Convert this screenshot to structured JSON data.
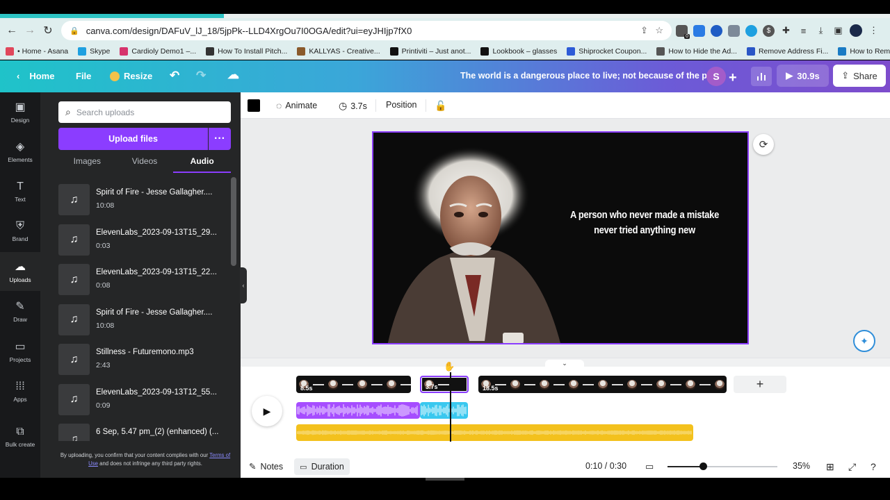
{
  "browser": {
    "url": "canva.com/design/DAFuV_lJ_18/5jpPk--LLD4XrgOu7I0OGA/edit?ui=eyJHIjp7fX0",
    "bookmarks": [
      {
        "label": "• Home - Asana",
        "color": "#e0475b"
      },
      {
        "label": "Skype",
        "color": "#1ea0e0"
      },
      {
        "label": "Cardioly Demo1 –...",
        "color": "#d6336c"
      },
      {
        "label": "How To Install Pitch...",
        "color": "#333333"
      },
      {
        "label": "KALLYAS - Creative...",
        "color": "#8a5a2b"
      },
      {
        "label": "Printiviti – Just anot...",
        "color": "#111111"
      },
      {
        "label": "Lookbook – glasses",
        "color": "#111111"
      },
      {
        "label": "Shiprocket Coupon...",
        "color": "#2d5bd7"
      },
      {
        "label": "How to Hide the Ad...",
        "color": "#555555"
      },
      {
        "label": "Remove Address Fi...",
        "color": "#2a56c6"
      },
      {
        "label": "How to Remove / D...",
        "color": "#1a7bc4"
      }
    ],
    "extension_badge": "0"
  },
  "header": {
    "home": "Home",
    "file": "File",
    "resize": "Resize",
    "title": "The world is a dangerous place to live; not because of the p...",
    "avatar_initial": "S",
    "play_time": "30.9s",
    "share": "Share"
  },
  "rail": [
    {
      "label": "Design",
      "icon": "design-icon",
      "glyph": "▣"
    },
    {
      "label": "Elements",
      "icon": "elements-icon",
      "glyph": "◈"
    },
    {
      "label": "Text",
      "icon": "text-icon",
      "glyph": "T"
    },
    {
      "label": "Brand",
      "icon": "brand-icon",
      "glyph": "⛨"
    },
    {
      "label": "Uploads",
      "icon": "uploads-icon",
      "glyph": "☁"
    },
    {
      "label": "Draw",
      "icon": "draw-icon",
      "glyph": "✎"
    },
    {
      "label": "Projects",
      "icon": "projects-icon",
      "glyph": "▭"
    },
    {
      "label": "Apps",
      "icon": "apps-icon",
      "glyph": "⁞⁞⁞"
    },
    {
      "label": "Bulk create",
      "icon": "bulk-create-icon",
      "glyph": "⧉"
    }
  ],
  "panel": {
    "search_placeholder": "Search uploads",
    "upload_label": "Upload files",
    "tabs": [
      "Images",
      "Videos",
      "Audio"
    ],
    "active_tab": "Audio",
    "audio_items": [
      {
        "name": "Spirit of Fire - Jesse Gallagher....",
        "duration": "10:08"
      },
      {
        "name": "ElevenLabs_2023-09-13T15_29...",
        "duration": "0:03"
      },
      {
        "name": "ElevenLabs_2023-09-13T15_22...",
        "duration": "0:08"
      },
      {
        "name": "Spirit of Fire - Jesse Gallagher....",
        "duration": "10:08"
      },
      {
        "name": "Stillness - Futuremono.mp3",
        "duration": "2:43"
      },
      {
        "name": "ElevenLabs_2023-09-13T12_55...",
        "duration": "0:09"
      },
      {
        "name": "6 Sep, 5.47 pm_(2) (enhanced) (...",
        "duration": ""
      }
    ],
    "disclaimer_pre": "By uploading, you confirm that your content complies with our",
    "disclaimer_link": "Terms of Use",
    "disclaimer_post": "and does not infringe any third party rights."
  },
  "toolbar": {
    "animate": "Animate",
    "duration": "3.7s",
    "position": "Position"
  },
  "canvas": {
    "quote": "A person who never made a mistake never tried anything new"
  },
  "timeline": {
    "clips": [
      {
        "duration": "8.5s",
        "heads": 4
      },
      {
        "duration": "3.7s",
        "heads": 1
      },
      {
        "duration": "18.5s",
        "heads": 9
      }
    ],
    "add_clip": "+"
  },
  "bottom_bar": {
    "notes": "Notes",
    "duration": "Duration",
    "time": "0:10 / 0:30",
    "zoom": "35%",
    "zoom_level": 0.32
  },
  "colors": {
    "accent": "#8b3dff",
    "voice_track": "#a64dff",
    "voice_track_selected": "#39c8ef",
    "music_track": "#f3c11d"
  }
}
